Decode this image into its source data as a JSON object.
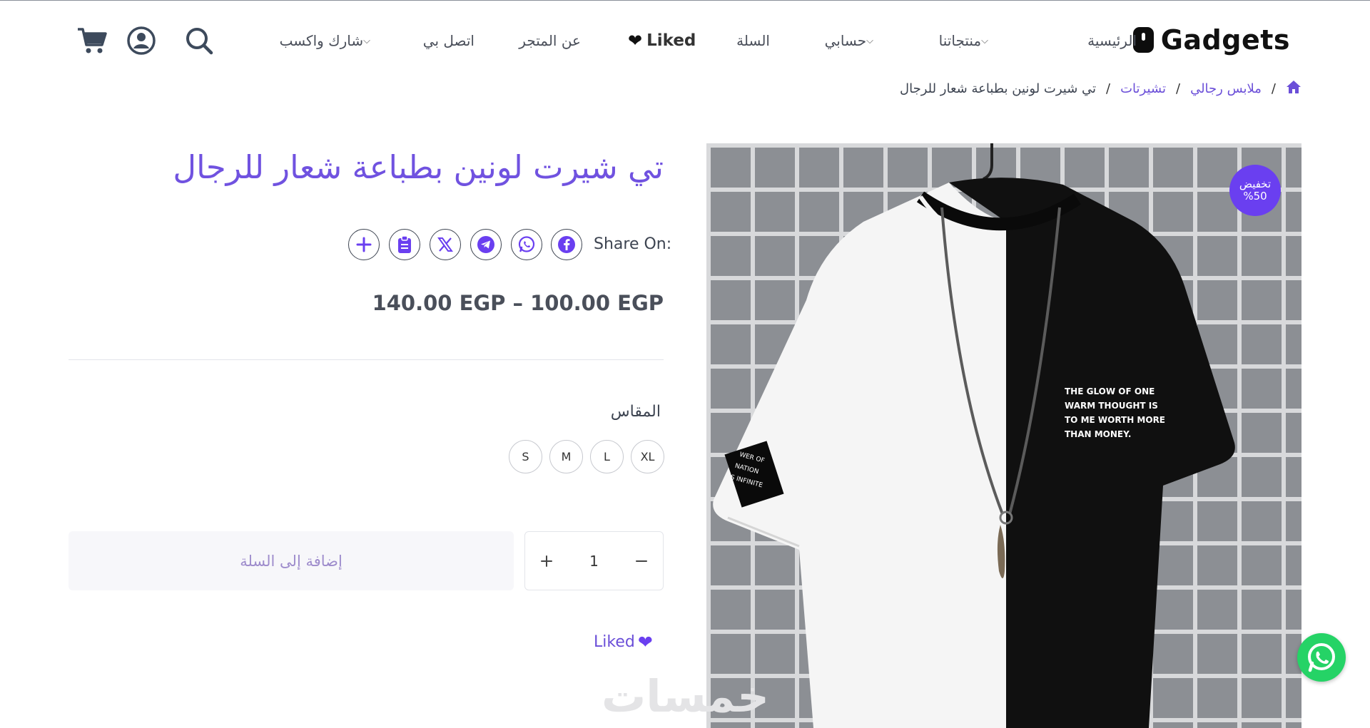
{
  "brand": {
    "name": "Gadgets",
    "logo_icon": "phone-icon"
  },
  "nav": {
    "home": "الرئيسية",
    "products": "منتجاتنا",
    "account": "حسابي",
    "cart": "السلة",
    "liked": "Liked",
    "about": "عن المتجر",
    "contact": "اتصل بي",
    "affiliate": "شارك واكسب"
  },
  "header_icons": [
    "search-icon",
    "user-icon",
    "cart-icon"
  ],
  "breadcrumb": {
    "home_icon": "home-icon",
    "level1": "ملابس رجالي",
    "level2": "تشيرتات",
    "current": "تي شيرت لونين بطباعة شعار للرجال",
    "separator": "/"
  },
  "product": {
    "title": "تي شيرت لونين بطباعة شعار للرجال",
    "sale_badge": {
      "line1": "تخفيض",
      "line2": "%50"
    },
    "share_label": "Share On:",
    "share_buttons": [
      "facebook-icon",
      "whatsapp-icon",
      "telegram-icon",
      "x-icon",
      "clipboard-icon",
      "plus-icon"
    ],
    "price_range": "140.00 EGP – 100.00 EGP",
    "size_label": "المقاس",
    "sizes": [
      "XL",
      "L",
      "M",
      "S"
    ],
    "add_to_cart": "إضافة إلى السلة",
    "quantity": "1",
    "liked_link": "Liked",
    "image_text": {
      "line1": "THE GLOW OF ONE",
      "line2": "WARM THOUGHT IS",
      "line3": "TO ME WORTH MORE",
      "line4": "THAN MONEY.",
      "sleeve1": "WER OF",
      "sleeve2": "NATION",
      "sleeve3": "S INFINITE"
    }
  },
  "watermark": "خمسات",
  "colors": {
    "accent": "#6a3ff0",
    "title": "#7052e0",
    "whatsapp": "#25d366"
  }
}
